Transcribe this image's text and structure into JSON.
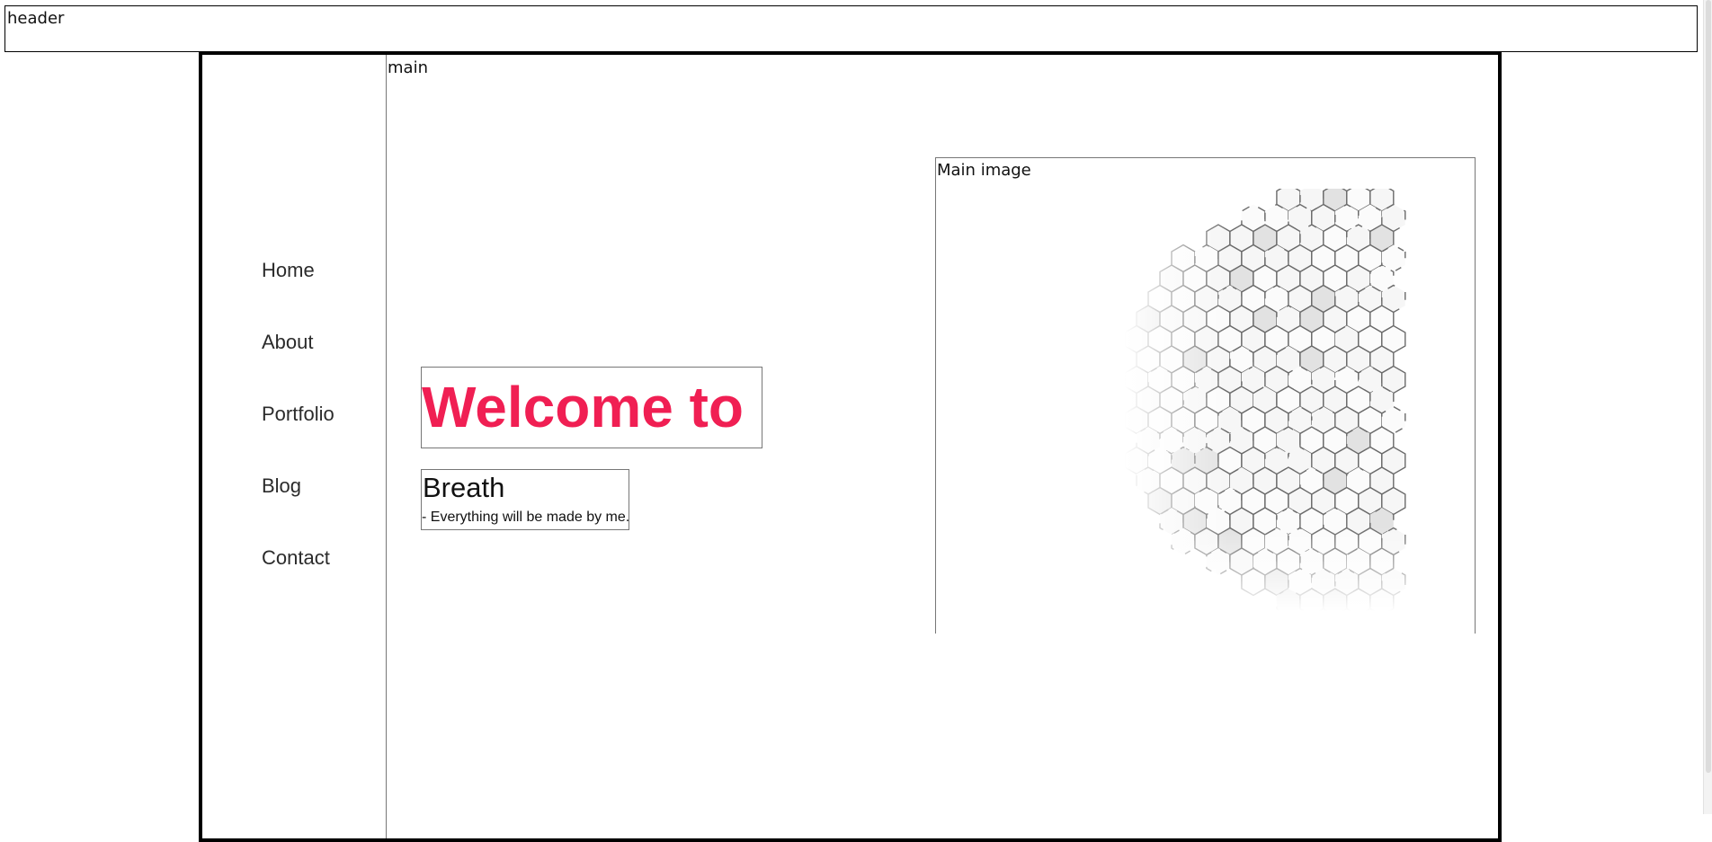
{
  "header": {
    "label": "header"
  },
  "nav": {
    "items": [
      {
        "label": "Home"
      },
      {
        "label": "About"
      },
      {
        "label": "Portfolio"
      },
      {
        "label": "Blog"
      },
      {
        "label": "Contact"
      }
    ]
  },
  "main": {
    "label": "main",
    "welcome": {
      "text": "Welcome to Breath",
      "color": "#f01f53"
    },
    "tagline": {
      "title": "Breath",
      "subtitle": "- Everything will be made by me."
    },
    "image": {
      "label": "Main image",
      "icon": "hexagon-pattern-image"
    }
  }
}
